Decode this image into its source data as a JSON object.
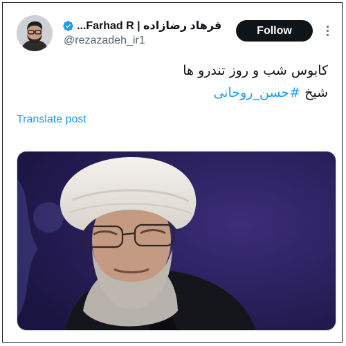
{
  "author": {
    "display_name": "فرهاد رضازاده | Farhad R...",
    "handle": "@rezazadeh_ir1",
    "verified": true
  },
  "actions": {
    "follow_label": "Follow",
    "more_icon": "more-dots-icon"
  },
  "tweet": {
    "line1": "کابوس شب و روز تندرو ها",
    "line2_prefix": "شیخ ",
    "hashtag": "#حسن_روحانی"
  },
  "translate_label": "Translate post",
  "colors": {
    "accent": "#1d9bf0",
    "text": "#0f1419",
    "muted": "#536471",
    "button_bg": "#0f1419"
  }
}
